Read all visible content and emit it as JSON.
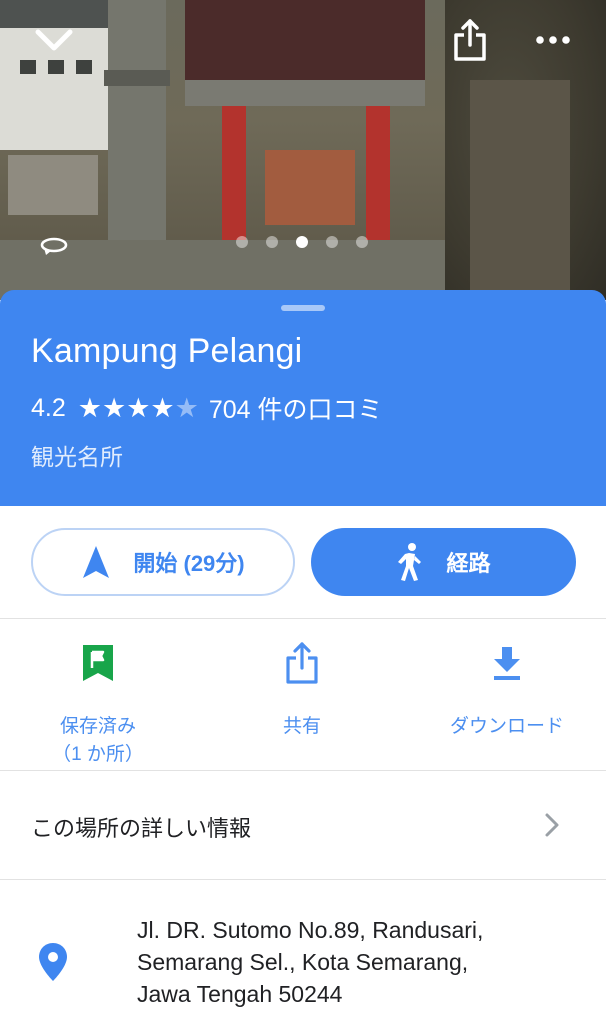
{
  "header": {
    "back_icon": "chevron-down-icon",
    "share_icon": "share-icon",
    "more_icon": "more-horizontal-icon",
    "rotate_icon": "360-rotate-icon",
    "photo_count": 5,
    "photo_active_index": 2
  },
  "place": {
    "title": "Kampung Pelangi",
    "rating": "4.2",
    "stars_filled": 4,
    "stars_total": 5,
    "reviews": "704 件の口コミ",
    "category": "観光名所"
  },
  "actions": {
    "start_label": "開始 (29分)",
    "start_icon": "navigation-arrow-icon",
    "route_label": "経路",
    "route_icon": "walking-person-icon"
  },
  "quick_actions": {
    "save_line1": "保存済み",
    "save_line2": "（1 か所）",
    "share_label": "共有",
    "download_label": "ダウンロード"
  },
  "details": {
    "label": "この場所の詳しい情報"
  },
  "address": {
    "line1": "Jl. DR. Sutomo No.89, Randusari,",
    "line2": "Semarang Sel., Kota Semarang,",
    "line3": "Jawa Tengah 50244"
  },
  "colors": {
    "accent_blue": "#3f86f0",
    "save_green": "#18a54a",
    "text_dark": "#202124"
  }
}
